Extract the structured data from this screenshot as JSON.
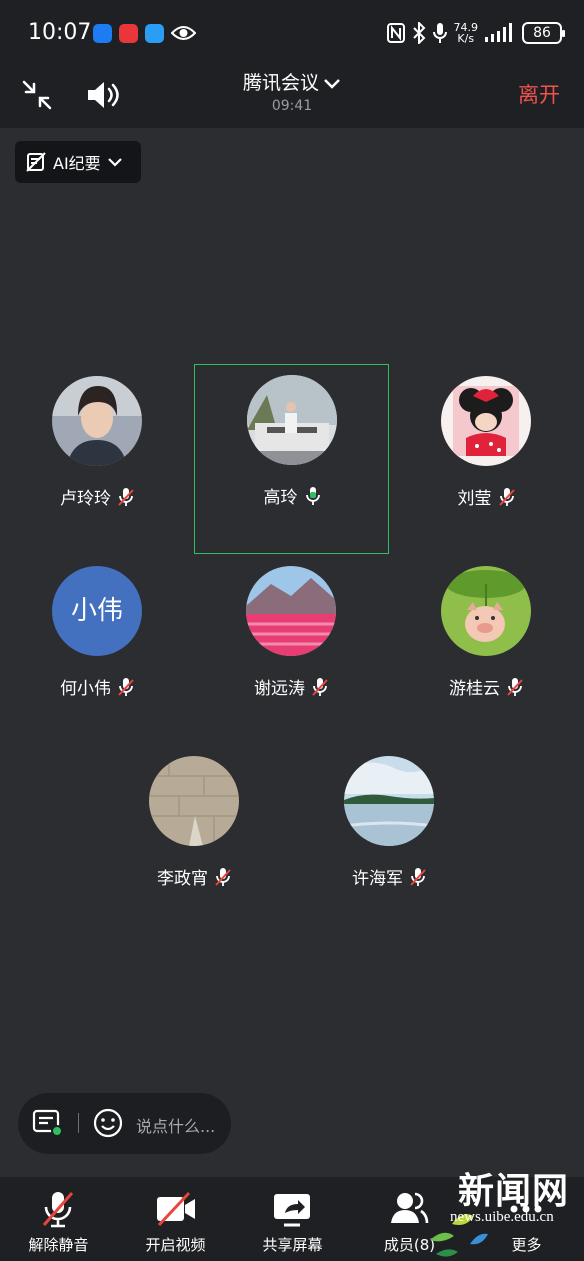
{
  "status_bar": {
    "time": "10:07",
    "net_speed_value": "74.9",
    "net_speed_unit": "K/s",
    "battery": "86"
  },
  "header": {
    "title": "腾讯会议",
    "meeting_time": "09:41",
    "leave_label": "离开",
    "leave_color": "#f0524d"
  },
  "ai_summary": {
    "label": "AI纪要"
  },
  "participants": [
    {
      "name": "卢玲玲",
      "mic": "muted",
      "avatar": "photo-woman"
    },
    {
      "name": "高玲",
      "mic": "speaking",
      "avatar": "photo-outdoor",
      "active_speaker": true
    },
    {
      "name": "刘莹",
      "mic": "muted",
      "avatar": "cartoon-minnie"
    },
    {
      "name": "何小伟",
      "mic": "muted",
      "avatar_text": "小伟",
      "avatar_color": "#4470c0"
    },
    {
      "name": "谢远涛",
      "mic": "muted",
      "avatar": "photo-flower-field"
    },
    {
      "name": "游桂云",
      "mic": "muted",
      "avatar": "cartoon-pig"
    },
    {
      "name": "李政宵",
      "mic": "muted",
      "avatar": "photo-wall"
    },
    {
      "name": "许海军",
      "mic": "muted",
      "avatar": "photo-lake"
    }
  ],
  "chat": {
    "placeholder": "说点什么..."
  },
  "toolbar": {
    "items": [
      {
        "label": "解除静音",
        "icon": "mic-off-icon"
      },
      {
        "label": "开启视频",
        "icon": "video-off-icon"
      },
      {
        "label": "共享屏幕",
        "icon": "share-screen-icon"
      },
      {
        "label": "成员(8)",
        "icon": "members-icon"
      },
      {
        "label": "更多",
        "icon": "more-icon"
      }
    ]
  },
  "watermark": {
    "title": "新闻网",
    "url": "news.uibe.edu.cn"
  },
  "colors": {
    "background": "#2b2d31",
    "bar": "#1f2023",
    "active_speaker_border": "#2fbf62",
    "muted_red": "#e8453c"
  }
}
